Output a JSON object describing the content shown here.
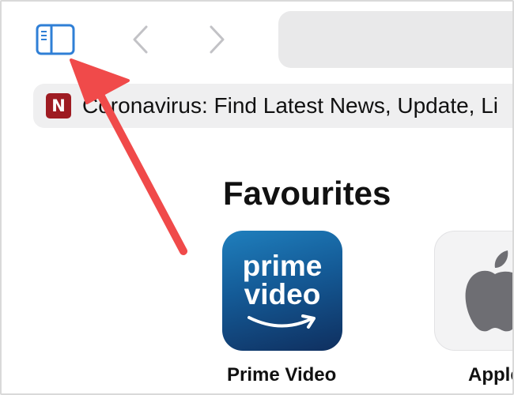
{
  "toolbar": {
    "sidebar_icon": "sidebar-icon",
    "back_icon": "chevron-left-icon",
    "forward_icon": "chevron-right-icon",
    "address_text": ""
  },
  "tab": {
    "favicon_letter": "N",
    "title": "Coronavirus: Find Latest News, Update, Li"
  },
  "favourites": {
    "heading": "Favourites",
    "items": [
      {
        "label": "Prime Video",
        "tile_line1": "prime",
        "tile_line2": "video",
        "icon": "prime-video-icon"
      },
      {
        "label": "Apple",
        "icon": "apple-logo-icon"
      }
    ]
  },
  "annotation": {
    "icon": "red-arrow-icon",
    "color": "#f04a4a"
  },
  "colors": {
    "accent": "#2f7fd6",
    "favicon_bg": "#9e1b22",
    "address_bg": "#e9e9ea",
    "tab_bg": "#efeff0"
  }
}
